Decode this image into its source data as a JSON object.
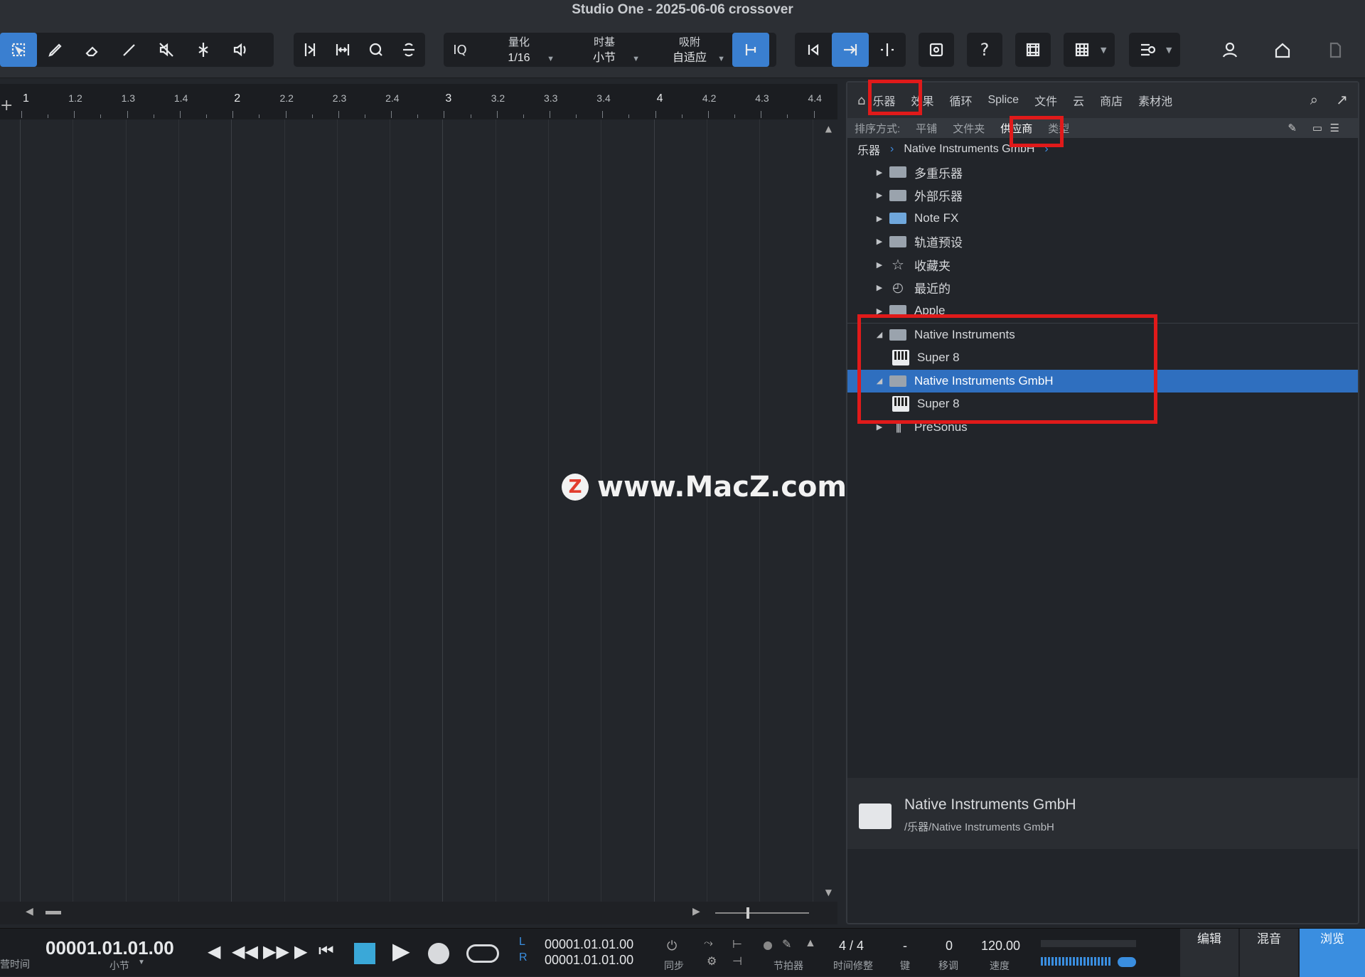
{
  "window": {
    "title": "Studio One - 2025-06-06 crossover"
  },
  "toolbar": {
    "quantize": {
      "label": "量化",
      "value": "1/16"
    },
    "timebase": {
      "label": "时基",
      "value": "小节"
    },
    "snap": {
      "label": "吸附",
      "value": "自适应"
    },
    "iq_label": "IQ",
    "help_label": "?"
  },
  "ruler": {
    "ticks": [
      "1",
      "1.2",
      "1.3",
      "1.4",
      "2",
      "2.2",
      "2.3",
      "2.4",
      "3",
      "3.2",
      "3.3",
      "3.4",
      "4",
      "4.2",
      "4.3",
      "4.4"
    ]
  },
  "browser": {
    "tabs": [
      "乐器",
      "效果",
      "循环",
      "Splice",
      "文件",
      "云",
      "商店",
      "素材池"
    ],
    "active_tab": "乐器",
    "sort": {
      "label": "排序方式:",
      "options": [
        "平铺",
        "文件夹",
        "供应商",
        "类型"
      ],
      "active": "供应商"
    },
    "breadcrumb": [
      "乐器",
      "Native Instruments GmbH"
    ],
    "tree": [
      {
        "label": "多重乐器",
        "icon": "multi-instrument-folder-icon",
        "level": 0,
        "expanded": false
      },
      {
        "label": "外部乐器",
        "icon": "external-instrument-icon",
        "level": 0,
        "expanded": false
      },
      {
        "label": "Note FX",
        "icon": "folder-icon",
        "level": 0,
        "expanded": false
      },
      {
        "label": "轨道预设",
        "icon": "track-preset-icon",
        "level": 0,
        "expanded": false
      },
      {
        "label": "收藏夹",
        "icon": "star-icon",
        "level": 0,
        "expanded": false
      },
      {
        "label": "最近的",
        "icon": "clock-icon",
        "level": 0,
        "expanded": false
      },
      {
        "label": "Apple",
        "icon": "folder-icon",
        "level": 0,
        "expanded": false
      },
      {
        "label": "Native Instruments",
        "icon": "open-folder-icon",
        "level": 0,
        "expanded": true
      },
      {
        "label": "Super 8",
        "icon": "piano-plugin-icon",
        "level": 1
      },
      {
        "label": "Native Instruments GmbH",
        "icon": "open-folder-icon",
        "level": 0,
        "expanded": true,
        "selected": true
      },
      {
        "label": "Super 8",
        "icon": "piano-plugin-icon",
        "level": 1
      },
      {
        "label": "PreSonus",
        "icon": "presonus-icon",
        "level": 0,
        "expanded": false
      }
    ],
    "info": {
      "name": "Native Instruments GmbH",
      "path": "/乐器/Native Instruments GmbH"
    }
  },
  "watermark": {
    "text": "www.MacZ.com",
    "logo": "Z"
  },
  "transport": {
    "position": "00001.01.01.00",
    "position_left_label": "营时间",
    "position_unit": "小节",
    "loop_l_label": "L",
    "loop_r_label": "R",
    "loop_start": "00001.01.01.00",
    "loop_end": "00001.01.01.00",
    "sync_label": "同步",
    "metronome_label": "节拍器",
    "time_signature": "4 / 4",
    "time_signature_label": "时间修整",
    "key": "-",
    "key_label": "键",
    "transpose": "0",
    "transpose_label": "移调",
    "tempo": "120.00",
    "tempo_label": "速度",
    "modes": [
      "编辑",
      "混音",
      "浏览"
    ],
    "active_mode": "浏览"
  },
  "colors": {
    "accent": "#3a8ee0",
    "highlight_box": "#e01a1a",
    "selection": "#2f6fbf"
  }
}
